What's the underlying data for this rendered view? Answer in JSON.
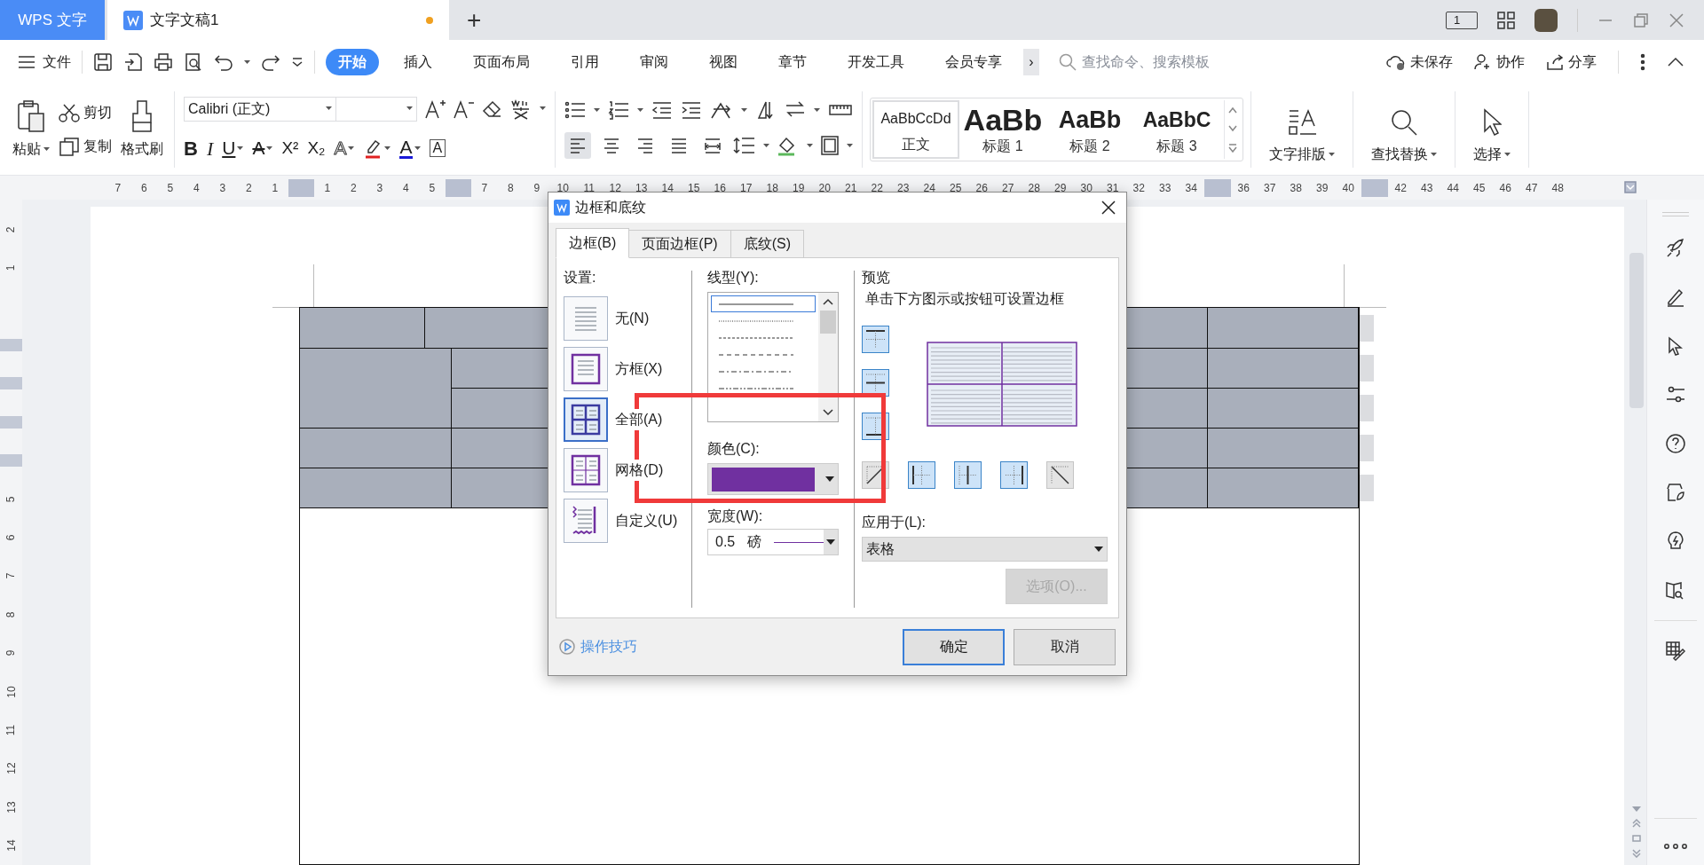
{
  "title_bar": {
    "tabs": [
      {
        "label": "WPS 文字",
        "selected": false,
        "kind": "home"
      },
      {
        "label": "文字文稿1",
        "selected": true,
        "kind": "document",
        "unsaved": true
      }
    ],
    "new_tab": "+",
    "window_count": "1"
  },
  "menu": {
    "file": "文件",
    "tabs": [
      {
        "label": "开始",
        "selected": true
      },
      {
        "label": "插入",
        "selected": false
      },
      {
        "label": "页面布局",
        "selected": false
      },
      {
        "label": "引用",
        "selected": false
      },
      {
        "label": "审阅",
        "selected": false
      },
      {
        "label": "视图",
        "selected": false
      },
      {
        "label": "章节",
        "selected": false
      },
      {
        "label": "开发工具",
        "selected": false
      },
      {
        "label": "会员专享",
        "selected": false
      }
    ],
    "more": "›",
    "search": {
      "placeholder": "查找命令、搜索模板"
    },
    "actions": [
      {
        "label": "未保存",
        "kind": "cloud"
      },
      {
        "label": "协作",
        "kind": "user"
      },
      {
        "label": "分享",
        "kind": "share"
      }
    ]
  },
  "ribbon": {
    "clipboard": {
      "paste": "粘贴",
      "cut": "剪切",
      "copy": "复制",
      "format_painter": "格式刷"
    },
    "font": {
      "name": "Calibri (正文)",
      "format_buttons": [
        {
          "glyph": "B",
          "kind": "bold"
        },
        {
          "glyph": "I",
          "kind": "italic"
        },
        {
          "glyph": "U",
          "kind": "underline"
        },
        {
          "glyph": "A",
          "kind": "strike"
        },
        {
          "glyph": "X²",
          "kind": "superscript"
        },
        {
          "glyph": "X₂",
          "kind": "subscript"
        },
        {
          "glyph": "A",
          "kind": "effect"
        },
        {
          "glyph": "A",
          "kind": "font_color"
        },
        {
          "glyph": "A",
          "kind": "char_border"
        }
      ]
    },
    "alignment": [
      {
        "kind": "left",
        "selected": true
      },
      {
        "kind": "center",
        "selected": false
      },
      {
        "kind": "right",
        "selected": false
      },
      {
        "kind": "justify",
        "selected": false
      },
      {
        "kind": "distributed",
        "selected": false
      }
    ],
    "styles": [
      {
        "sample": "AaBbCcDd",
        "label": "正文",
        "selected": true,
        "kind": "normal"
      },
      {
        "sample": "AaBb",
        "label": "标题 1",
        "selected": false,
        "kind": "heading1"
      },
      {
        "sample": "AaBb",
        "label": "标题 2",
        "selected": false,
        "kind": "heading2"
      },
      {
        "sample": "AaBbC",
        "label": "标题 3",
        "selected": false,
        "kind": "heading3"
      }
    ],
    "tools": [
      {
        "label": "文字排版",
        "kind": "layout"
      },
      {
        "label": "查找替换",
        "kind": "find"
      },
      {
        "label": "选择",
        "kind": "select"
      }
    ]
  },
  "ruler": {
    "horizontal": [
      {
        "kind": "number",
        "label": "7"
      },
      {
        "kind": "number",
        "label": "6"
      },
      {
        "kind": "number",
        "label": "5"
      },
      {
        "kind": "number",
        "label": "4"
      },
      {
        "kind": "number",
        "label": "3"
      },
      {
        "kind": "number",
        "label": "2"
      },
      {
        "kind": "number",
        "label": "1"
      },
      {
        "kind": "marker"
      },
      {
        "kind": "number",
        "label": "1"
      },
      {
        "kind": "number",
        "label": "2"
      },
      {
        "kind": "number",
        "label": "3"
      },
      {
        "kind": "number",
        "label": "4"
      },
      {
        "kind": "number",
        "label": "5"
      },
      {
        "kind": "marker"
      },
      {
        "kind": "number",
        "label": "7"
      },
      {
        "kind": "number",
        "label": "8"
      },
      {
        "kind": "number",
        "label": "9"
      },
      {
        "kind": "number",
        "label": "10"
      },
      {
        "kind": "number",
        "label": "11"
      },
      {
        "kind": "number",
        "label": "12"
      },
      {
        "kind": "number",
        "label": "13"
      },
      {
        "kind": "number",
        "label": "14"
      },
      {
        "kind": "number",
        "label": "15"
      },
      {
        "kind": "number",
        "label": "16"
      },
      {
        "kind": "number",
        "label": "17"
      },
      {
        "kind": "number",
        "label": "18"
      },
      {
        "kind": "number",
        "label": "19"
      },
      {
        "kind": "number",
        "label": "20"
      },
      {
        "kind": "number",
        "label": "21"
      },
      {
        "kind": "number",
        "label": "22"
      },
      {
        "kind": "number",
        "label": "23"
      },
      {
        "kind": "number",
        "label": "24"
      },
      {
        "kind": "number",
        "label": "25"
      },
      {
        "kind": "number",
        "label": "26"
      },
      {
        "kind": "number",
        "label": "27"
      },
      {
        "kind": "number",
        "label": "28"
      },
      {
        "kind": "number",
        "label": "29"
      },
      {
        "kind": "number",
        "label": "30"
      },
      {
        "kind": "number",
        "label": "31"
      },
      {
        "kind": "number",
        "label": "32"
      },
      {
        "kind": "number",
        "label": "33"
      },
      {
        "kind": "number",
        "label": "34"
      },
      {
        "kind": "marker"
      },
      {
        "kind": "number",
        "label": "36"
      },
      {
        "kind": "number",
        "label": "37"
      },
      {
        "kind": "number",
        "label": "38"
      },
      {
        "kind": "number",
        "label": "39"
      },
      {
        "kind": "number",
        "label": "40"
      },
      {
        "kind": "marker"
      },
      {
        "kind": "number",
        "label": "42"
      },
      {
        "kind": "number",
        "label": "43"
      },
      {
        "kind": "number",
        "label": "44"
      },
      {
        "kind": "number",
        "label": "45"
      },
      {
        "kind": "number",
        "label": "46"
      },
      {
        "kind": "number",
        "label": "47"
      },
      {
        "kind": "number",
        "label": "48"
      }
    ],
    "vertical": [
      {
        "kind": "number",
        "label": "2"
      },
      {
        "kind": "number",
        "label": "1"
      },
      {
        "kind": "blank"
      },
      {
        "kind": "marker"
      },
      {
        "kind": "marker"
      },
      {
        "kind": "marker"
      },
      {
        "kind": "marker"
      },
      {
        "kind": "number",
        "label": "5"
      },
      {
        "kind": "number",
        "label": "6"
      },
      {
        "kind": "number",
        "label": "7"
      },
      {
        "kind": "number",
        "label": "8"
      },
      {
        "kind": "number",
        "label": "9"
      },
      {
        "kind": "number",
        "label": "10"
      },
      {
        "kind": "number",
        "label": "11"
      },
      {
        "kind": "number",
        "label": "12"
      },
      {
        "kind": "number",
        "label": "13"
      },
      {
        "kind": "number",
        "label": "14"
      }
    ]
  },
  "dialog": {
    "title": "边框和底纹",
    "tabs": [
      {
        "label": "边框(B)",
        "selected": true
      },
      {
        "label": "页面边框(P)",
        "selected": false
      },
      {
        "label": "底纹(S)",
        "selected": false
      }
    ],
    "settings": {
      "label": "设置:",
      "options": [
        {
          "label": "无(N)",
          "kind": "none",
          "selected": false
        },
        {
          "label": "方框(X)",
          "kind": "box",
          "selected": false
        },
        {
          "label": "全部(A)",
          "kind": "all",
          "selected": true
        },
        {
          "label": "网格(D)",
          "kind": "grid",
          "selected": false
        },
        {
          "label": "自定义(U)",
          "kind": "custom",
          "selected": false
        }
      ]
    },
    "line_style": {
      "label": "线型(Y):",
      "options": [
        {
          "kind": "solid",
          "selected": true
        },
        {
          "kind": "dotted",
          "selected": false
        },
        {
          "kind": "dashed",
          "selected": false
        },
        {
          "kind": "long_dash",
          "selected": false
        },
        {
          "kind": "dash_dot",
          "selected": false
        },
        {
          "kind": "dash_dot_dot",
          "selected": false
        }
      ]
    },
    "color": {
      "label": "颜色(C):",
      "color": "#7030a0"
    },
    "width": {
      "label": "宽度(W):",
      "value": "0.5",
      "unit": "磅"
    },
    "preview": {
      "title": "预览",
      "hint": "单击下方图示或按钮可设置边框",
      "side_buttons": [
        {
          "kind": "top",
          "on": true
        },
        {
          "kind": "middle",
          "on": true
        },
        {
          "kind": "bottom",
          "on": true
        }
      ],
      "bottom_buttons": [
        {
          "kind": "diagonal_up",
          "on": false
        },
        {
          "kind": "left",
          "on": true
        },
        {
          "kind": "center",
          "on": true
        },
        {
          "kind": "right",
          "on": true
        },
        {
          "kind": "diagonal_down",
          "on": false
        }
      ]
    },
    "apply_to": {
      "label": "应用于(L):",
      "value": "表格"
    },
    "options_button": {
      "label": "选项(O)...",
      "disabled": true
    },
    "tips": "操作技巧",
    "ok": "确定",
    "cancel": "取消"
  }
}
